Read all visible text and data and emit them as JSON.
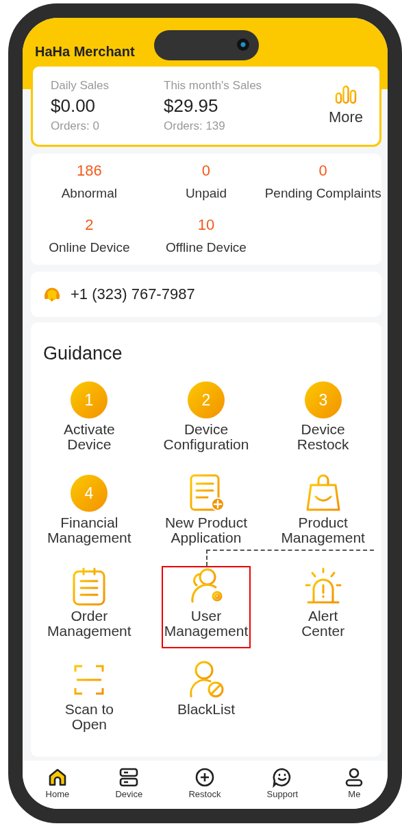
{
  "app": {
    "title": "HaHa Merchant"
  },
  "sales": [
    {
      "label": "Daily Sales",
      "amount": "$0.00",
      "orders": "Orders: 0"
    },
    {
      "label": "This month's Sales",
      "amount": "$29.95",
      "orders": "Orders: 139"
    }
  ],
  "more_button": {
    "label": "More"
  },
  "stats": [
    {
      "value": "186",
      "label": "Abnormal"
    },
    {
      "value": "0",
      "label": "Unpaid"
    },
    {
      "value": "0",
      "label": "Pending Complaints"
    },
    {
      "value": "2",
      "label": "Online Device"
    },
    {
      "value": "10",
      "label": "Offline Device"
    }
  ],
  "support_phone": "+1 (323) 767-7987",
  "guidance": {
    "title": "Guidance",
    "items": [
      {
        "kind": "step",
        "number": "1",
        "label": "Activate\nDevice",
        "highlighted": false
      },
      {
        "kind": "step",
        "number": "2",
        "label": "Device\nConfiguration",
        "highlighted": false
      },
      {
        "kind": "step",
        "number": "3",
        "label": "Device\nRestock",
        "highlighted": false
      },
      {
        "kind": "step",
        "number": "4",
        "label": "Financial\nManagement",
        "highlighted": false
      },
      {
        "kind": "document",
        "label": "New Product\nApplication",
        "highlighted": false
      },
      {
        "kind": "bag",
        "label": "Product\nManagement",
        "highlighted": false
      },
      {
        "kind": "clipboard",
        "label": "Order\nManagement",
        "highlighted": false
      },
      {
        "kind": "user-gear",
        "label": "User\nManagement",
        "highlighted": true
      },
      {
        "kind": "alarm",
        "label": "Alert\nCenter",
        "highlighted": false
      },
      {
        "kind": "scan",
        "label": "Scan to\nOpen",
        "highlighted": false
      },
      {
        "kind": "user-block",
        "label": "BlackList",
        "highlighted": false
      }
    ]
  },
  "nav": [
    {
      "kind": "home",
      "label": "Home",
      "selected": true
    },
    {
      "kind": "device",
      "label": "Device",
      "selected": false
    },
    {
      "kind": "restock",
      "label": "Restock",
      "selected": false
    },
    {
      "kind": "support",
      "label": "Support",
      "selected": false
    },
    {
      "kind": "me",
      "label": "Me",
      "selected": false
    }
  ]
}
